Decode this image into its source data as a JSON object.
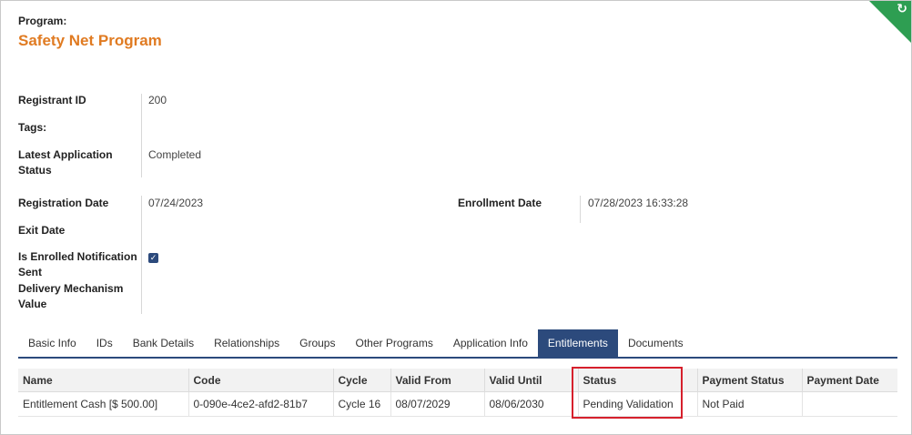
{
  "header": {
    "program_label": "Program:",
    "program_name": "Safety Net Program"
  },
  "fields": {
    "registrant_id_label": "Registrant ID",
    "registrant_id_value": "200",
    "tags_label": "Tags:",
    "latest_status_label_1": "Latest Application",
    "latest_status_label_2": "Status",
    "latest_status_value": "Completed",
    "registration_date_label": "Registration Date",
    "registration_date_value": "07/24/2023",
    "enrollment_date_label": "Enrollment Date",
    "enrollment_date_value": "07/28/2023 16:33:28",
    "exit_date_label": "Exit Date",
    "enrolled_notif_label_1": "Is Enrolled Notification",
    "enrolled_notif_label_2": "Sent",
    "enrolled_notif_checked": true,
    "delivery_label_1": "Delivery Mechanism",
    "delivery_label_2": "Value"
  },
  "tabs": [
    {
      "label": "Basic Info"
    },
    {
      "label": "IDs"
    },
    {
      "label": "Bank Details"
    },
    {
      "label": "Relationships"
    },
    {
      "label": "Groups"
    },
    {
      "label": "Other Programs"
    },
    {
      "label": "Application Info"
    },
    {
      "label": "Entitlements"
    },
    {
      "label": "Documents"
    }
  ],
  "active_tab": "Entitlements",
  "table": {
    "columns": [
      "Name",
      "Code",
      "Cycle",
      "Valid From",
      "Valid Until",
      "Status",
      "Payment Status",
      "Payment Date"
    ],
    "rows": [
      [
        "Entitlement Cash [$ 500.00]",
        "0-090e-4ce2-afd2-81b7",
        "Cycle 16",
        "08/07/2029",
        "08/06/2030",
        "Pending Validation",
        "Not Paid",
        ""
      ]
    ]
  },
  "colors": {
    "accent": "#e07b22",
    "tab_active": "#2c4a7c",
    "highlight": "#d6202c",
    "corner": "#2e9e52"
  }
}
